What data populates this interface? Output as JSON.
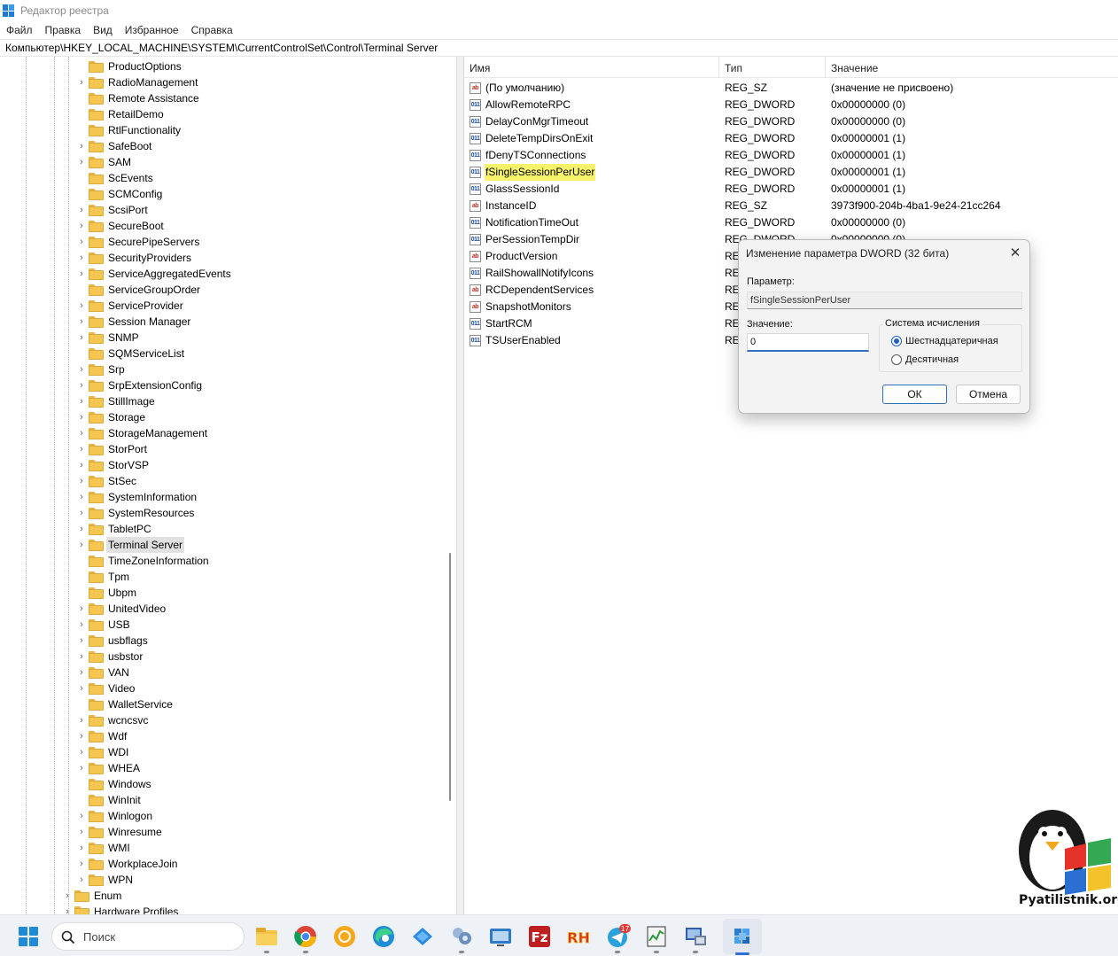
{
  "window": {
    "title": "Редактор реестра"
  },
  "menu": [
    "Файл",
    "Правка",
    "Вид",
    "Избранное",
    "Справка"
  ],
  "address": "Компьютер\\HKEY_LOCAL_MACHINE\\SYSTEM\\CurrentControlSet\\Control\\Terminal Server",
  "tree": {
    "items": [
      {
        "label": "ProductOptions",
        "expandable": false
      },
      {
        "label": "RadioManagement",
        "expandable": true
      },
      {
        "label": "Remote Assistance",
        "expandable": false
      },
      {
        "label": "RetailDemo",
        "expandable": false
      },
      {
        "label": "RtlFunctionality",
        "expandable": false
      },
      {
        "label": "SafeBoot",
        "expandable": true
      },
      {
        "label": "SAM",
        "expandable": true
      },
      {
        "label": "ScEvents",
        "expandable": false
      },
      {
        "label": "SCMConfig",
        "expandable": false
      },
      {
        "label": "ScsiPort",
        "expandable": true
      },
      {
        "label": "SecureBoot",
        "expandable": true
      },
      {
        "label": "SecurePipeServers",
        "expandable": true
      },
      {
        "label": "SecurityProviders",
        "expandable": true
      },
      {
        "label": "ServiceAggregatedEvents",
        "expandable": true
      },
      {
        "label": "ServiceGroupOrder",
        "expandable": false
      },
      {
        "label": "ServiceProvider",
        "expandable": true
      },
      {
        "label": "Session Manager",
        "expandable": true
      },
      {
        "label": "SNMP",
        "expandable": true
      },
      {
        "label": "SQMServiceList",
        "expandable": false
      },
      {
        "label": "Srp",
        "expandable": true
      },
      {
        "label": "SrpExtensionConfig",
        "expandable": true
      },
      {
        "label": "StillImage",
        "expandable": true
      },
      {
        "label": "Storage",
        "expandable": true
      },
      {
        "label": "StorageManagement",
        "expandable": true
      },
      {
        "label": "StorPort",
        "expandable": true
      },
      {
        "label": "StorVSP",
        "expandable": true
      },
      {
        "label": "StSec",
        "expandable": true
      },
      {
        "label": "SystemInformation",
        "expandable": true
      },
      {
        "label": "SystemResources",
        "expandable": true
      },
      {
        "label": "TabletPC",
        "expandable": true
      },
      {
        "label": "Terminal Server",
        "expandable": true,
        "selected": true
      },
      {
        "label": "TimeZoneInformation",
        "expandable": false
      },
      {
        "label": "Tpm",
        "expandable": false
      },
      {
        "label": "Ubpm",
        "expandable": false
      },
      {
        "label": "UnitedVideo",
        "expandable": true
      },
      {
        "label": "USB",
        "expandable": true
      },
      {
        "label": "usbflags",
        "expandable": true
      },
      {
        "label": "usbstor",
        "expandable": true
      },
      {
        "label": "VAN",
        "expandable": true
      },
      {
        "label": "Video",
        "expandable": true
      },
      {
        "label": "WalletService",
        "expandable": false
      },
      {
        "label": "wcncsvc",
        "expandable": true
      },
      {
        "label": "Wdf",
        "expandable": true
      },
      {
        "label": "WDI",
        "expandable": true
      },
      {
        "label": "WHEA",
        "expandable": true
      },
      {
        "label": "Windows",
        "expandable": false
      },
      {
        "label": "WinInit",
        "expandable": false
      },
      {
        "label": "Winlogon",
        "expandable": true
      },
      {
        "label": "Winresume",
        "expandable": true
      },
      {
        "label": "WMI",
        "expandable": true
      },
      {
        "label": "WorkplaceJoin",
        "expandable": true
      },
      {
        "label": "WPN",
        "expandable": true
      }
    ],
    "parent_items": [
      {
        "label": "Enum",
        "expandable": true
      },
      {
        "label": "Hardware Profiles",
        "expandable": true
      }
    ]
  },
  "values": {
    "columns": [
      "Имя",
      "Тип",
      "Значение"
    ],
    "rows": [
      {
        "name": "(По умолчанию)",
        "type": "REG_SZ",
        "data": "(значение не присвоено)",
        "kind": "sz"
      },
      {
        "name": "AllowRemoteRPC",
        "type": "REG_DWORD",
        "data": "0x00000000 (0)",
        "kind": "dw"
      },
      {
        "name": "DelayConMgrTimeout",
        "type": "REG_DWORD",
        "data": "0x00000000 (0)",
        "kind": "dw"
      },
      {
        "name": "DeleteTempDirsOnExit",
        "type": "REG_DWORD",
        "data": "0x00000001 (1)",
        "kind": "dw"
      },
      {
        "name": "fDenyTSConnections",
        "type": "REG_DWORD",
        "data": "0x00000001 (1)",
        "kind": "dw"
      },
      {
        "name": "fSingleSessionPerUser",
        "type": "REG_DWORD",
        "data": "0x00000001 (1)",
        "kind": "dw",
        "highlight": true
      },
      {
        "name": "GlassSessionId",
        "type": "REG_DWORD",
        "data": "0x00000001 (1)",
        "kind": "dw"
      },
      {
        "name": "InstanceID",
        "type": "REG_SZ",
        "data": "3973f900-204b-4ba1-9e24-21cc264",
        "kind": "sz"
      },
      {
        "name": "NotificationTimeOut",
        "type": "REG_DWORD",
        "data": "0x00000000 (0)",
        "kind": "dw"
      },
      {
        "name": "PerSessionTempDir",
        "type": "REG_DWORD",
        "data": "0x00000000 (0)",
        "kind": "dw"
      },
      {
        "name": "ProductVersion",
        "type": "REG_SZ",
        "data": "",
        "kind": "sz"
      },
      {
        "name": "RailShowallNotifyIcons",
        "type": "REG_DWORD",
        "data": "",
        "kind": "dw"
      },
      {
        "name": "RCDependentServices",
        "type": "REG_MULTI_SZ",
        "data": "",
        "kind": "sz"
      },
      {
        "name": "SnapshotMonitors",
        "type": "REG_SZ",
        "data": "",
        "kind": "sz"
      },
      {
        "name": "StartRCM",
        "type": "REG_DWORD",
        "data": "",
        "kind": "dw"
      },
      {
        "name": "TSUserEnabled",
        "type": "REG_DWORD",
        "data": "",
        "kind": "dw"
      }
    ]
  },
  "dialog": {
    "title": "Изменение параметра DWORD (32 бита)",
    "close_glyph": "✕",
    "param_label": "Параметр:",
    "param_value": "fSingleSessionPerUser",
    "value_label": "Значение:",
    "value": "0",
    "base_group_title": "Система исчисления",
    "base_options": [
      {
        "label": "Шестнадцатеричная",
        "selected": true
      },
      {
        "label": "Десятичная",
        "selected": false
      }
    ],
    "ok_label": "ОК",
    "cancel_label": "Отмена"
  },
  "watermark": {
    "text": "Pyatilistnik.org"
  },
  "taskbar": {
    "search_placeholder": "Поиск",
    "apps": [
      {
        "icon": "file-explorer-icon"
      },
      {
        "icon": "chrome-icon"
      },
      {
        "icon": "yandex-browser-icon"
      },
      {
        "icon": "edge-icon"
      },
      {
        "icon": "remote-desktop-icon"
      },
      {
        "icon": "network-tool-icon"
      },
      {
        "icon": "remote-viewer-icon"
      },
      {
        "icon": "filezilla-icon"
      },
      {
        "icon": "resource-hacker-icon"
      },
      {
        "icon": "telegram-icon",
        "badge": "17"
      },
      {
        "icon": "task-manager-icon"
      },
      {
        "icon": "remote-connection-icon"
      },
      {
        "icon": "registry-editor-icon",
        "active": true
      }
    ]
  },
  "colors": {
    "accent": "#2f6fc0",
    "highlight": "#f6f36b",
    "folder": "#f4c650"
  }
}
